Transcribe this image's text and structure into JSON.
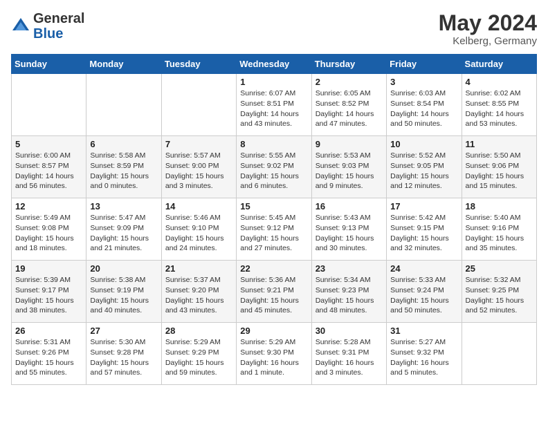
{
  "logo": {
    "general": "General",
    "blue": "Blue"
  },
  "header": {
    "month": "May 2024",
    "location": "Kelberg, Germany"
  },
  "weekdays": [
    "Sunday",
    "Monday",
    "Tuesday",
    "Wednesday",
    "Thursday",
    "Friday",
    "Saturday"
  ],
  "rows": [
    [
      {
        "day": "",
        "sunrise": "",
        "sunset": "",
        "daylight": ""
      },
      {
        "day": "",
        "sunrise": "",
        "sunset": "",
        "daylight": ""
      },
      {
        "day": "",
        "sunrise": "",
        "sunset": "",
        "daylight": ""
      },
      {
        "day": "1",
        "sunrise": "Sunrise: 6:07 AM",
        "sunset": "Sunset: 8:51 PM",
        "daylight": "Daylight: 14 hours and 43 minutes."
      },
      {
        "day": "2",
        "sunrise": "Sunrise: 6:05 AM",
        "sunset": "Sunset: 8:52 PM",
        "daylight": "Daylight: 14 hours and 47 minutes."
      },
      {
        "day": "3",
        "sunrise": "Sunrise: 6:03 AM",
        "sunset": "Sunset: 8:54 PM",
        "daylight": "Daylight: 14 hours and 50 minutes."
      },
      {
        "day": "4",
        "sunrise": "Sunrise: 6:02 AM",
        "sunset": "Sunset: 8:55 PM",
        "daylight": "Daylight: 14 hours and 53 minutes."
      }
    ],
    [
      {
        "day": "5",
        "sunrise": "Sunrise: 6:00 AM",
        "sunset": "Sunset: 8:57 PM",
        "daylight": "Daylight: 14 hours and 56 minutes."
      },
      {
        "day": "6",
        "sunrise": "Sunrise: 5:58 AM",
        "sunset": "Sunset: 8:59 PM",
        "daylight": "Daylight: 15 hours and 0 minutes."
      },
      {
        "day": "7",
        "sunrise": "Sunrise: 5:57 AM",
        "sunset": "Sunset: 9:00 PM",
        "daylight": "Daylight: 15 hours and 3 minutes."
      },
      {
        "day": "8",
        "sunrise": "Sunrise: 5:55 AM",
        "sunset": "Sunset: 9:02 PM",
        "daylight": "Daylight: 15 hours and 6 minutes."
      },
      {
        "day": "9",
        "sunrise": "Sunrise: 5:53 AM",
        "sunset": "Sunset: 9:03 PM",
        "daylight": "Daylight: 15 hours and 9 minutes."
      },
      {
        "day": "10",
        "sunrise": "Sunrise: 5:52 AM",
        "sunset": "Sunset: 9:05 PM",
        "daylight": "Daylight: 15 hours and 12 minutes."
      },
      {
        "day": "11",
        "sunrise": "Sunrise: 5:50 AM",
        "sunset": "Sunset: 9:06 PM",
        "daylight": "Daylight: 15 hours and 15 minutes."
      }
    ],
    [
      {
        "day": "12",
        "sunrise": "Sunrise: 5:49 AM",
        "sunset": "Sunset: 9:08 PM",
        "daylight": "Daylight: 15 hours and 18 minutes."
      },
      {
        "day": "13",
        "sunrise": "Sunrise: 5:47 AM",
        "sunset": "Sunset: 9:09 PM",
        "daylight": "Daylight: 15 hours and 21 minutes."
      },
      {
        "day": "14",
        "sunrise": "Sunrise: 5:46 AM",
        "sunset": "Sunset: 9:10 PM",
        "daylight": "Daylight: 15 hours and 24 minutes."
      },
      {
        "day": "15",
        "sunrise": "Sunrise: 5:45 AM",
        "sunset": "Sunset: 9:12 PM",
        "daylight": "Daylight: 15 hours and 27 minutes."
      },
      {
        "day": "16",
        "sunrise": "Sunrise: 5:43 AM",
        "sunset": "Sunset: 9:13 PM",
        "daylight": "Daylight: 15 hours and 30 minutes."
      },
      {
        "day": "17",
        "sunrise": "Sunrise: 5:42 AM",
        "sunset": "Sunset: 9:15 PM",
        "daylight": "Daylight: 15 hours and 32 minutes."
      },
      {
        "day": "18",
        "sunrise": "Sunrise: 5:40 AM",
        "sunset": "Sunset: 9:16 PM",
        "daylight": "Daylight: 15 hours and 35 minutes."
      }
    ],
    [
      {
        "day": "19",
        "sunrise": "Sunrise: 5:39 AM",
        "sunset": "Sunset: 9:17 PM",
        "daylight": "Daylight: 15 hours and 38 minutes."
      },
      {
        "day": "20",
        "sunrise": "Sunrise: 5:38 AM",
        "sunset": "Sunset: 9:19 PM",
        "daylight": "Daylight: 15 hours and 40 minutes."
      },
      {
        "day": "21",
        "sunrise": "Sunrise: 5:37 AM",
        "sunset": "Sunset: 9:20 PM",
        "daylight": "Daylight: 15 hours and 43 minutes."
      },
      {
        "day": "22",
        "sunrise": "Sunrise: 5:36 AM",
        "sunset": "Sunset: 9:21 PM",
        "daylight": "Daylight: 15 hours and 45 minutes."
      },
      {
        "day": "23",
        "sunrise": "Sunrise: 5:34 AM",
        "sunset": "Sunset: 9:23 PM",
        "daylight": "Daylight: 15 hours and 48 minutes."
      },
      {
        "day": "24",
        "sunrise": "Sunrise: 5:33 AM",
        "sunset": "Sunset: 9:24 PM",
        "daylight": "Daylight: 15 hours and 50 minutes."
      },
      {
        "day": "25",
        "sunrise": "Sunrise: 5:32 AM",
        "sunset": "Sunset: 9:25 PM",
        "daylight": "Daylight: 15 hours and 52 minutes."
      }
    ],
    [
      {
        "day": "26",
        "sunrise": "Sunrise: 5:31 AM",
        "sunset": "Sunset: 9:26 PM",
        "daylight": "Daylight: 15 hours and 55 minutes."
      },
      {
        "day": "27",
        "sunrise": "Sunrise: 5:30 AM",
        "sunset": "Sunset: 9:28 PM",
        "daylight": "Daylight: 15 hours and 57 minutes."
      },
      {
        "day": "28",
        "sunrise": "Sunrise: 5:29 AM",
        "sunset": "Sunset: 9:29 PM",
        "daylight": "Daylight: 15 hours and 59 minutes."
      },
      {
        "day": "29",
        "sunrise": "Sunrise: 5:29 AM",
        "sunset": "Sunset: 9:30 PM",
        "daylight": "Daylight: 16 hours and 1 minute."
      },
      {
        "day": "30",
        "sunrise": "Sunrise: 5:28 AM",
        "sunset": "Sunset: 9:31 PM",
        "daylight": "Daylight: 16 hours and 3 minutes."
      },
      {
        "day": "31",
        "sunrise": "Sunrise: 5:27 AM",
        "sunset": "Sunset: 9:32 PM",
        "daylight": "Daylight: 16 hours and 5 minutes."
      },
      {
        "day": "",
        "sunrise": "",
        "sunset": "",
        "daylight": ""
      }
    ]
  ]
}
